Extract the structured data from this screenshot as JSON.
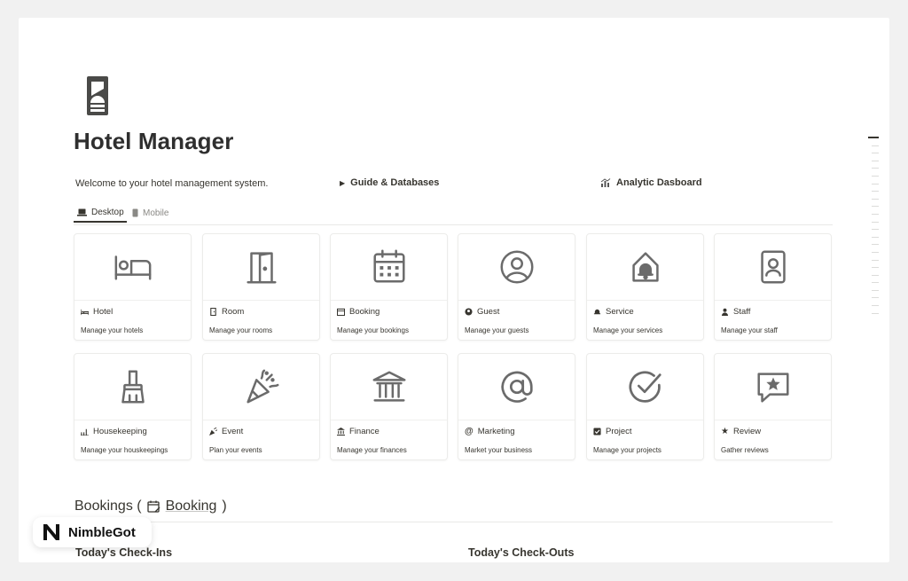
{
  "page": {
    "title": "Hotel Manager",
    "welcome": "Welcome to your hotel management system.",
    "guide_link": "Guide & Databases",
    "analytic_link": "Analytic Dasboard"
  },
  "tabs": [
    {
      "label": "Desktop",
      "active": true,
      "icon": "laptop-icon"
    },
    {
      "label": "Mobile",
      "active": false,
      "icon": "phone-icon"
    }
  ],
  "cards": [
    {
      "title": "Hotel",
      "desc": "Manage your hotels",
      "icon": "bed-icon"
    },
    {
      "title": "Room",
      "desc": "Manage your rooms",
      "icon": "door-icon"
    },
    {
      "title": "Booking",
      "desc": "Manage your bookings",
      "icon": "calendar-icon"
    },
    {
      "title": "Guest",
      "desc": "Manage your guests",
      "icon": "user-circle-icon"
    },
    {
      "title": "Service",
      "desc": "Manage your services",
      "icon": "bell-icon"
    },
    {
      "title": "Staff",
      "desc": "Manage your staff",
      "icon": "id-badge-icon"
    },
    {
      "title": "Housekeeping",
      "desc": "Manage your houskeepings",
      "icon": "broom-icon"
    },
    {
      "title": "Event",
      "desc": "Plan your events",
      "icon": "party-popper-icon"
    },
    {
      "title": "Finance",
      "desc": "Manage your finances",
      "icon": "bank-icon"
    },
    {
      "title": "Marketing",
      "desc": "Market your business",
      "icon": "at-sign-icon"
    },
    {
      "title": "Project",
      "desc": "Manage your projects",
      "icon": "check-circle-icon"
    },
    {
      "title": "Review",
      "desc": "Gather reviews",
      "icon": "star-message-icon"
    }
  ],
  "bookings_section": {
    "prefix": "Bookings (",
    "link": "Booking",
    "suffix": ")",
    "checkins": "Today's Check-Ins",
    "checkouts": "Today's Check-Outs"
  },
  "badge": {
    "text": "NimbleGot"
  },
  "colors": {
    "icon": "#6b6b6b",
    "text": "#37352f",
    "border": "#ececea"
  }
}
